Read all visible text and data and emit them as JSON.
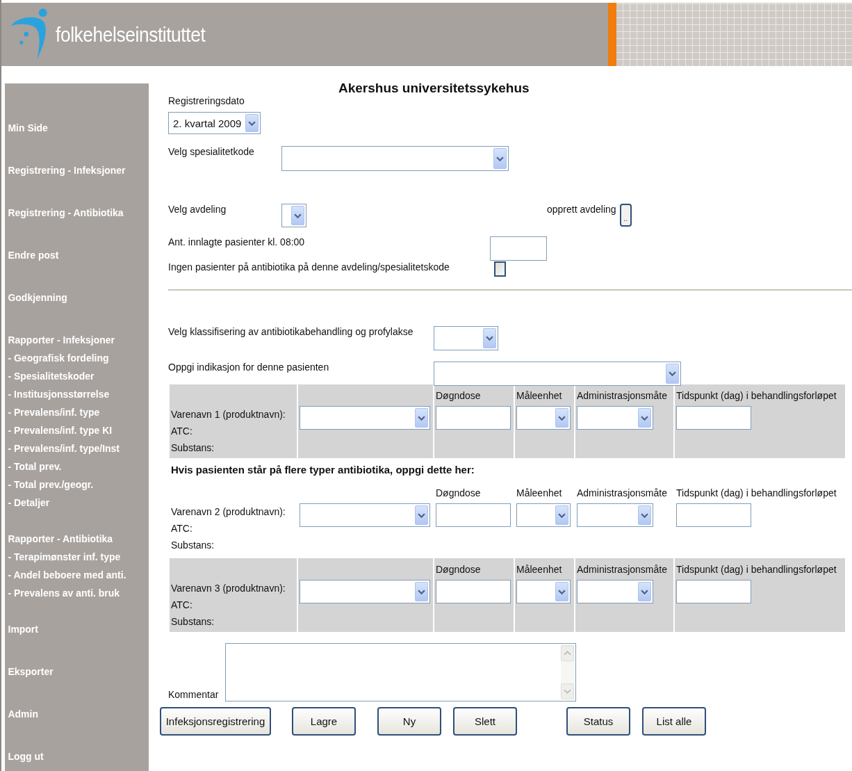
{
  "header": {
    "logo_text": "folkehelseinstituttet"
  },
  "sidebar": {
    "items": [
      {
        "label": "Min Side"
      },
      {
        "label": "Registrering - Infeksjoner"
      },
      {
        "label": "Registrering - Antibiotika"
      },
      {
        "label": "Endre post"
      },
      {
        "label": "Godkjenning"
      },
      {
        "label": "Rapporter - Infeksjoner",
        "children": [
          {
            "label": "- Geografisk fordeling"
          },
          {
            "label": "- Spesialitetskoder"
          },
          {
            "label": "- Institusjonsstørrelse"
          },
          {
            "label": "- Prevalens/inf. type"
          },
          {
            "label": "- Prevalens/inf. type KI"
          },
          {
            "label": "- Prevalens/inf. type/Inst"
          },
          {
            "label": "- Total prev."
          },
          {
            "label": "- Total prev./geogr."
          },
          {
            "label": "- Detaljer"
          }
        ]
      },
      {
        "label": "Rapporter - Antibiotika",
        "children": [
          {
            "label": "- Terapimønster inf. type"
          },
          {
            "label": "- Andel beboere med anti."
          },
          {
            "label": "- Prevalens av anti. bruk"
          }
        ]
      },
      {
        "label": "Import"
      },
      {
        "label": "Eksporter"
      },
      {
        "label": "Admin"
      },
      {
        "label": "Logg ut"
      }
    ]
  },
  "form": {
    "title": "Akershus universitetssykehus",
    "registration_date": {
      "label": "Registreringsdato",
      "value": "2. kvartal 2009"
    },
    "specialty": {
      "label": "Velg spesialitetkode"
    },
    "department": {
      "label": "Velg avdeling"
    },
    "create_department": {
      "label": "opprett avdeling",
      "button": ".."
    },
    "admitted": {
      "label": "Ant. innlagte pasienter kl. 08:00"
    },
    "no_patients": {
      "label": "Ingen pasienter på antibiotika på denne avdeling/spesialitetskode",
      "checked": false
    },
    "classification": {
      "label": "Velg klassifisering av antibiotikabehandling og profylakse"
    },
    "indication": {
      "label": "Oppgi indikasjon for denne pasienten"
    },
    "extra_note": "Hvis pasienten står på flere typer antibiotika, oppgi dette her:",
    "medicines": [
      {
        "name_label": "Varenavn 1 (produktnavn):",
        "atc_label": "ATC:",
        "substance_label": "Substans:",
        "shaded": true,
        "columns": [
          "Døgndose",
          "Måleenhet",
          "Administrasjonsmåte",
          "Tidspunkt (dag) i behandlingsforløpet"
        ]
      },
      {
        "name_label": "Varenavn 2 (produktnavn):",
        "atc_label": "ATC:",
        "substance_label": "Substans:",
        "shaded": false,
        "columns": [
          "Døgndose",
          "Måleenhet",
          "Administrasjonsmåte",
          "Tidspunkt (dag) i behandlingsforløpet"
        ]
      },
      {
        "name_label": "Varenavn 3 (produktnavn):",
        "atc_label": "ATC:",
        "substance_label": "Substans:",
        "shaded": true,
        "columns": [
          "Døgndose",
          "Måleenhet",
          "Administrasjonsmåte",
          "Tidspunkt (dag) i behandlingsforløpet"
        ]
      }
    ],
    "comment": {
      "label": "Kommentar"
    },
    "buttons": [
      "Infeksjonsregistrering",
      "Lagre",
      "Ny",
      "Slett",
      "Status",
      "List alle"
    ]
  }
}
